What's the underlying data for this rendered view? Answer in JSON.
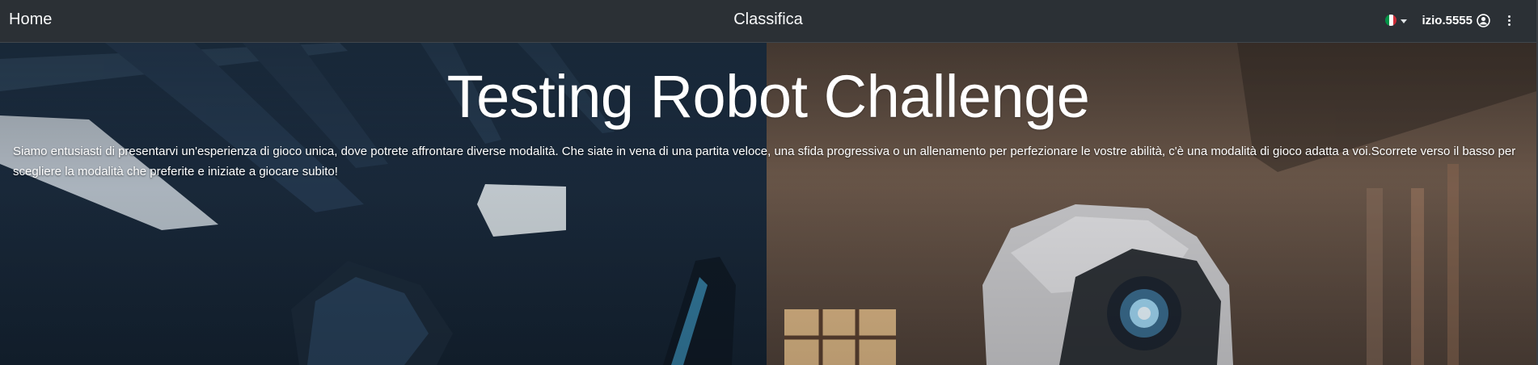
{
  "navbar": {
    "home_label": "Home",
    "center_label": "Classifica",
    "language": {
      "flag": "it-flag-icon",
      "colors": [
        "#009246",
        "#ffffff",
        "#ce2b37"
      ]
    },
    "username": "izio.5555",
    "user_icon": "user-circle-icon",
    "menu_icon": "kebab-menu-icon"
  },
  "hero": {
    "title": "Testing Robot Challenge",
    "description": "Siamo entusiasti di presentarvi un'esperienza di gioco unica, dove potrete affrontare diverse modalità. Che siate in vena di una partita veloce, una sfida progressiva o un allenamento per perfezionare le vostre abilità, c'è una modalità di gioco adatta a voi.Scorrete verso il basso per scegliere la modalità che preferite e iniziate a giocare subito!",
    "background": "robot-illustration-image"
  },
  "colors": {
    "navbar_bg": "#2b3035",
    "text": "#ffffff"
  }
}
